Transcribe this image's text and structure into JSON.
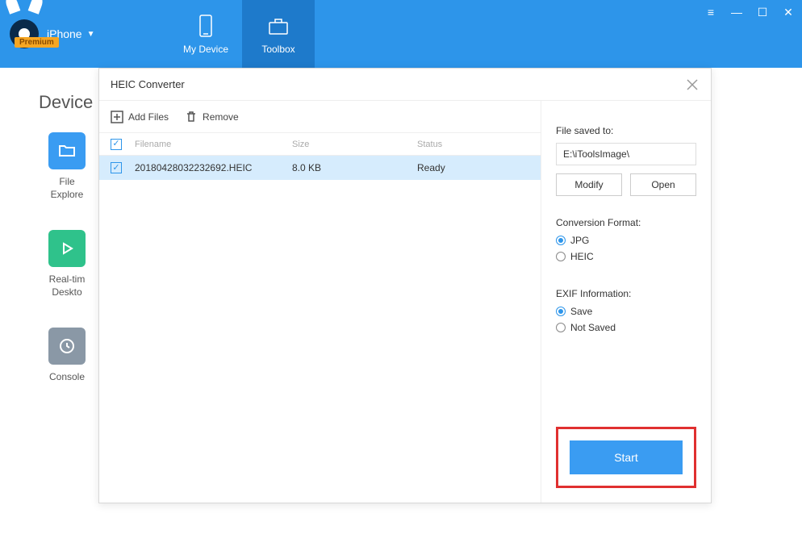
{
  "topbar": {
    "premium_label": "Premium",
    "device_label": "iPhone",
    "tabs": [
      {
        "label": "My Device"
      },
      {
        "label": "Toolbox"
      }
    ]
  },
  "bg": {
    "title": "Device",
    "items": [
      {
        "label1": "File",
        "label2": "Explore"
      },
      {
        "label1": "Real-tim",
        "label2": "Deskto"
      },
      {
        "label1": "Console",
        "label2": ""
      }
    ]
  },
  "modal": {
    "title": "HEIC Converter",
    "toolbar": {
      "add_files": "Add Files",
      "remove": "Remove"
    },
    "table": {
      "headers": {
        "filename": "Filename",
        "size": "Size",
        "status": "Status"
      },
      "rows": [
        {
          "filename": "20180428032232692.HEIC",
          "size": "8.0 KB",
          "status": "Ready",
          "checked": true
        }
      ]
    },
    "right": {
      "save_to_label": "File saved to:",
      "save_path": "E:\\iToolsImage\\",
      "modify": "Modify",
      "open": "Open",
      "format_label": "Conversion Format:",
      "format_options": [
        "JPG",
        "HEIC"
      ],
      "format_selected": "JPG",
      "exif_label": "EXIF Information:",
      "exif_options": [
        "Save",
        "Not Saved"
      ],
      "exif_selected": "Save",
      "start": "Start"
    }
  }
}
